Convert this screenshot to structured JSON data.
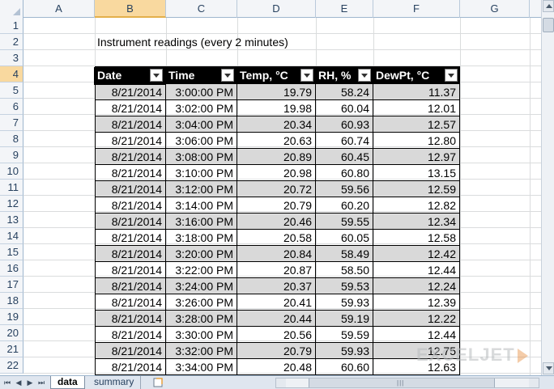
{
  "columns": [
    "A",
    "B",
    "C",
    "D",
    "E",
    "F",
    "G"
  ],
  "rows": [
    "1",
    "2",
    "3",
    "4",
    "5",
    "6",
    "7",
    "8",
    "9",
    "10",
    "11",
    "12",
    "13",
    "14",
    "15",
    "16",
    "17",
    "18",
    "19",
    "20",
    "21",
    "22"
  ],
  "title": "Instrument readings (every 2 minutes)",
  "table": {
    "headers": [
      "Date",
      "Time",
      "Temp, °C",
      "RH, %",
      "DewPt, °C"
    ],
    "rows": [
      [
        "8/21/2014",
        "3:00:00 PM",
        "19.79",
        "58.24",
        "11.37"
      ],
      [
        "8/21/2014",
        "3:02:00 PM",
        "19.98",
        "60.04",
        "12.01"
      ],
      [
        "8/21/2014",
        "3:04:00 PM",
        "20.34",
        "60.93",
        "12.57"
      ],
      [
        "8/21/2014",
        "3:06:00 PM",
        "20.63",
        "60.74",
        "12.80"
      ],
      [
        "8/21/2014",
        "3:08:00 PM",
        "20.89",
        "60.45",
        "12.97"
      ],
      [
        "8/21/2014",
        "3:10:00 PM",
        "20.98",
        "60.80",
        "13.15"
      ],
      [
        "8/21/2014",
        "3:12:00 PM",
        "20.72",
        "59.56",
        "12.59"
      ],
      [
        "8/21/2014",
        "3:14:00 PM",
        "20.79",
        "60.20",
        "12.82"
      ],
      [
        "8/21/2014",
        "3:16:00 PM",
        "20.46",
        "59.55",
        "12.34"
      ],
      [
        "8/21/2014",
        "3:18:00 PM",
        "20.58",
        "60.05",
        "12.58"
      ],
      [
        "8/21/2014",
        "3:20:00 PM",
        "20.84",
        "58.49",
        "12.42"
      ],
      [
        "8/21/2014",
        "3:22:00 PM",
        "20.87",
        "58.50",
        "12.44"
      ],
      [
        "8/21/2014",
        "3:24:00 PM",
        "20.37",
        "59.53",
        "12.24"
      ],
      [
        "8/21/2014",
        "3:26:00 PM",
        "20.41",
        "59.93",
        "12.39"
      ],
      [
        "8/21/2014",
        "3:28:00 PM",
        "20.44",
        "59.19",
        "12.22"
      ],
      [
        "8/21/2014",
        "3:30:00 PM",
        "20.56",
        "59.59",
        "12.44"
      ],
      [
        "8/21/2014",
        "3:32:00 PM",
        "20.79",
        "59.93",
        "12.75"
      ],
      [
        "8/21/2014",
        "3:34:00 PM",
        "20.48",
        "60.60",
        "12.63"
      ]
    ]
  },
  "sheet_tabs": [
    "data",
    "summary"
  ],
  "active_tab": "data",
  "watermark": "EXCELJET",
  "colors": {
    "header_bg": "#000000",
    "band_shade": "#d9d9d9",
    "selected_header": "#f9d99f"
  }
}
